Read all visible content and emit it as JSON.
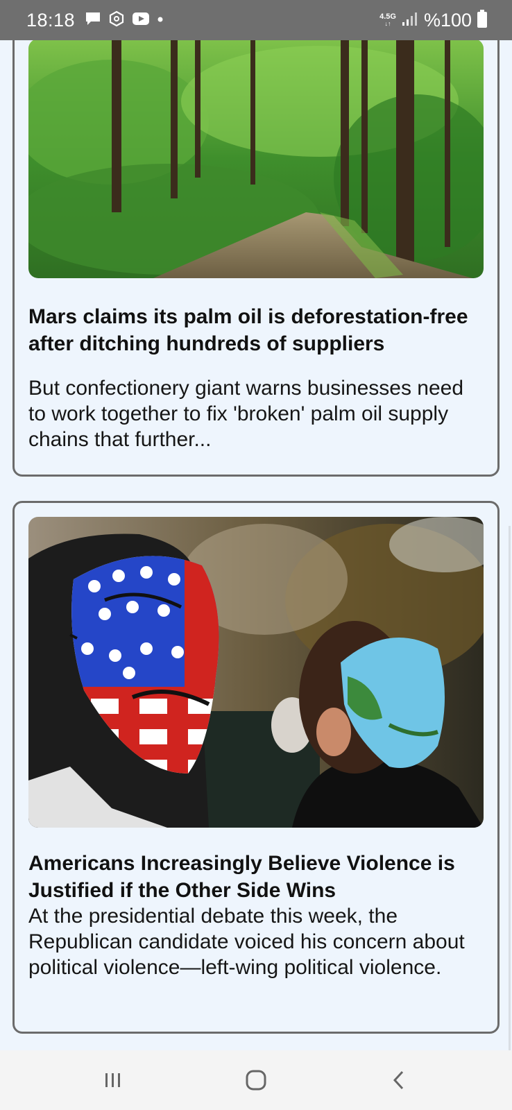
{
  "status_bar": {
    "time": "18:18",
    "icons": [
      "chat-bubble-icon",
      "hexagon-icon",
      "youtube-icon",
      "dot-icon"
    ],
    "network": "4.5G",
    "battery_text": "%100"
  },
  "feed": {
    "articles": [
      {
        "image": "forest-road-photo",
        "title": "Mars claims its palm oil is deforestation-free after ditching hundreds of suppliers",
        "summary": "But confectionery giant warns businesses need to work together to fix 'broken' palm oil supply chains that further..."
      },
      {
        "image": "masked-protesters-photo",
        "title": "Americans Increasingly Believe Violence is Justified if the Other Side Wins",
        "summary": "At the presidential debate this week, the Republican candidate voiced his concern about political violence—left-wing political violence."
      }
    ]
  },
  "nav_bar": {
    "buttons": [
      "recents-icon",
      "home-icon",
      "back-icon"
    ]
  },
  "colors": {
    "status_bar_bg": "#6f6f6f",
    "page_bg": "#eef5fd",
    "card_border": "#6b6b6b",
    "nav_bg": "#f4f4f4"
  }
}
